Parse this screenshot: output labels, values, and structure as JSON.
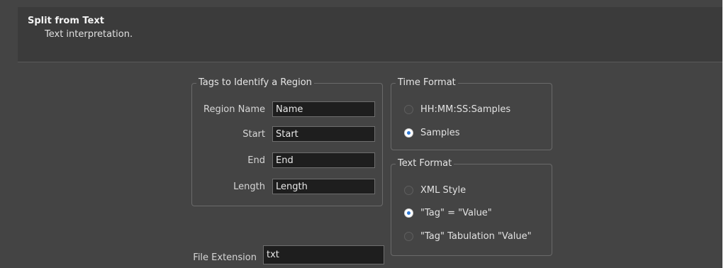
{
  "header": {
    "title": "Split from Text",
    "subtitle": "Text interpretation."
  },
  "tags_group": {
    "legend": "Tags to Identify a Region",
    "fields": [
      {
        "label": "Region Name",
        "value": "Name"
      },
      {
        "label": "Start",
        "value": "Start"
      },
      {
        "label": "End",
        "value": "End"
      },
      {
        "label": "Length",
        "value": "Length"
      }
    ]
  },
  "time_format": {
    "legend": "Time Format",
    "options": [
      {
        "label": "HH:MM:SS:Samples",
        "selected": false
      },
      {
        "label": "Samples",
        "selected": true
      }
    ]
  },
  "text_format": {
    "legend": "Text Format",
    "options": [
      {
        "label": "XML Style",
        "selected": false
      },
      {
        "label": "\"Tag\" = \"Value\"",
        "selected": true
      },
      {
        "label": "\"Tag\" Tabulation \"Value\"",
        "selected": false
      }
    ]
  },
  "file_extension": {
    "label": "File Extension",
    "value": "txt"
  }
}
